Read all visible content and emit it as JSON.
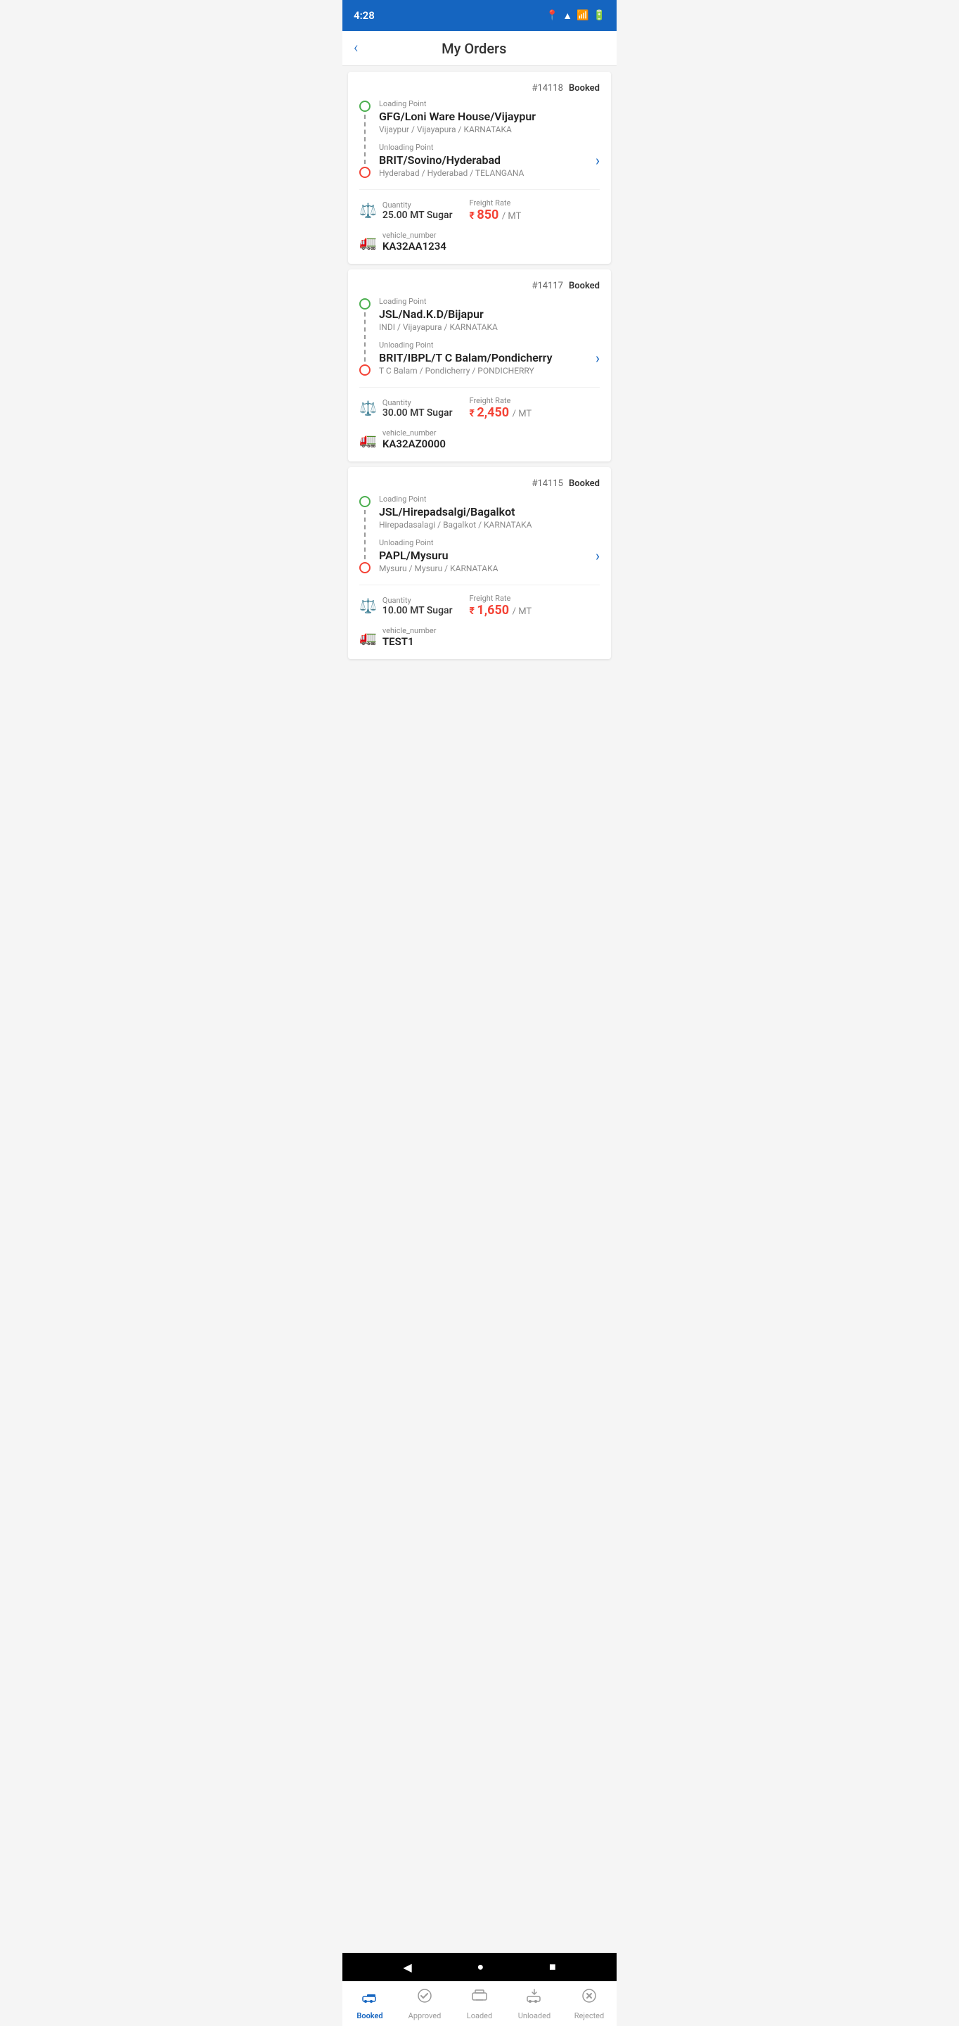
{
  "statusBar": {
    "time": "4:28",
    "icons": [
      "📍",
      "📶",
      "📶",
      "🔋"
    ]
  },
  "appBar": {
    "title": "My Orders",
    "backLabel": "‹"
  },
  "orders": [
    {
      "id": "#14118",
      "status": "Booked",
      "loadingLabel": "Loading Point",
      "loadingName": "GFG/Loni Ware House/Vijaypur",
      "loadingAddress": "Vijaypur / Vijayapura / KARNATAKA",
      "unloadingLabel": "Unloading Point",
      "unloadingName": "BRIT/Sovino/Hyderabad",
      "unloadingAddress": "Hyderabad / Hyderabad / TELANGANA",
      "quantityLabel": "Quantity",
      "quantityValue": "25.00 MT Sugar",
      "freightLabel": "Freight Rate",
      "freightValue": "850",
      "freightUnit": "/ MT",
      "vehicleLabel": "vehicle_number",
      "vehicleNumber": "KA32AA1234"
    },
    {
      "id": "#14117",
      "status": "Booked",
      "loadingLabel": "Loading Point",
      "loadingName": "JSL/Nad.K.D/Bijapur",
      "loadingAddress": "INDI / Vijayapura / KARNATAKA",
      "unloadingLabel": "Unloading Point",
      "unloadingName": "BRIT/IBPL/T C Balam/Pondicherry",
      "unloadingAddress": "T C Balam / Pondicherry / PONDICHERRY",
      "quantityLabel": "Quantity",
      "quantityValue": "30.00 MT Sugar",
      "freightLabel": "Freight Rate",
      "freightValue": "2,450",
      "freightUnit": "/ MT",
      "vehicleLabel": "vehicle_number",
      "vehicleNumber": "KA32AZ0000"
    },
    {
      "id": "#14115",
      "status": "Booked",
      "loadingLabel": "Loading Point",
      "loadingName": "JSL/Hirepadsalgi/Bagalkot",
      "loadingAddress": "Hirepadasalagi / Bagalkot / KARNATAKA",
      "unloadingLabel": "Unloading Point",
      "unloadingName": "PAPL/Mysuru",
      "unloadingAddress": "Mysuru / Mysuru / KARNATAKA",
      "quantityLabel": "Quantity",
      "quantityValue": "10.00 MT Sugar",
      "freightLabel": "Freight Rate",
      "freightValue": "1,650",
      "freightUnit": "/ MT",
      "vehicleLabel": "vehicle_number",
      "vehicleNumber": "TEST1"
    }
  ],
  "bottomNav": {
    "items": [
      {
        "label": "Booked",
        "icon": "🚛",
        "active": true
      },
      {
        "label": "Approved",
        "icon": "✅",
        "active": false
      },
      {
        "label": "Loaded",
        "icon": "🏭",
        "active": false
      },
      {
        "label": "Unloaded",
        "icon": "🚗",
        "active": false
      },
      {
        "label": "Rejected",
        "icon": "❌",
        "active": false
      }
    ]
  },
  "sysNav": {
    "back": "◀",
    "home": "●",
    "recent": "■"
  }
}
